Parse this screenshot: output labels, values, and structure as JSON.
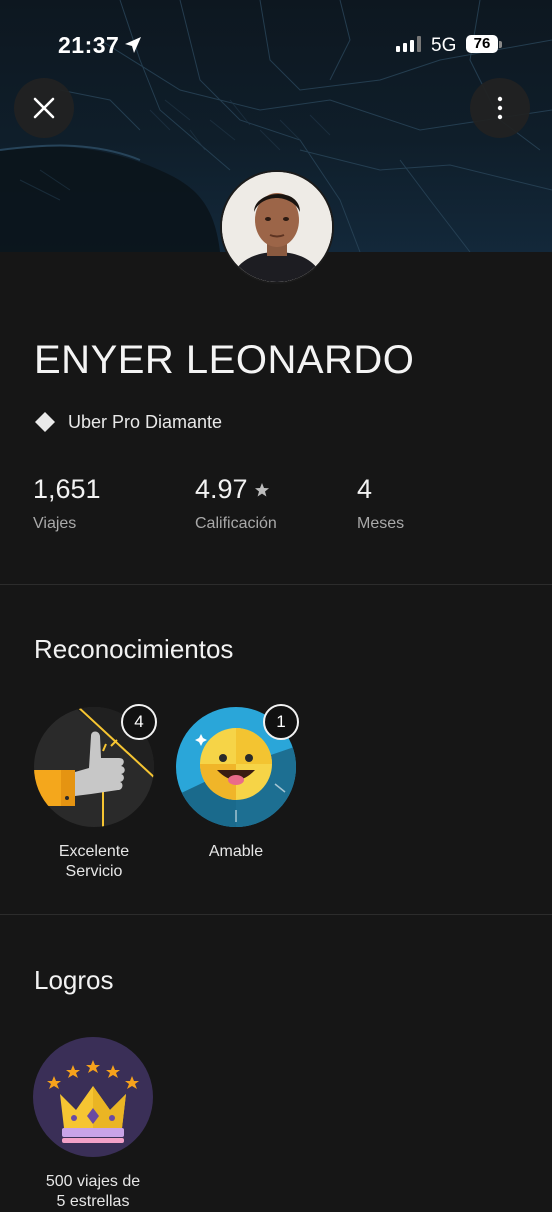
{
  "status_bar": {
    "time": "21:37",
    "network": "5G",
    "battery": "76"
  },
  "profile": {
    "name": "ENYER LEONARDO",
    "tier": "Uber Pro Diamante"
  },
  "stats": [
    {
      "value": "1,651",
      "label": "Viajes"
    },
    {
      "value": "4.97",
      "label": "Calificación"
    },
    {
      "value": "4",
      "label": "Meses"
    }
  ],
  "recognitions": {
    "title": "Reconocimientos",
    "items": [
      {
        "count": "4",
        "line1": "Excelente",
        "line2": "Servicio"
      },
      {
        "count": "1",
        "line1": "Amable",
        "line2": ""
      }
    ]
  },
  "achievements": {
    "title": "Logros",
    "items": [
      {
        "line1": "500 viajes de",
        "line2": "5 estrellas"
      }
    ]
  },
  "icons": {
    "close": "close-icon",
    "more": "more-vertical-icon",
    "tier": "diamond-icon",
    "rating": "star-icon"
  },
  "colors": {
    "background": "#161616",
    "accent_yellow": "#f6c532",
    "accent_blue": "#2aa6d9",
    "muted_text": "#a9a9a9"
  }
}
